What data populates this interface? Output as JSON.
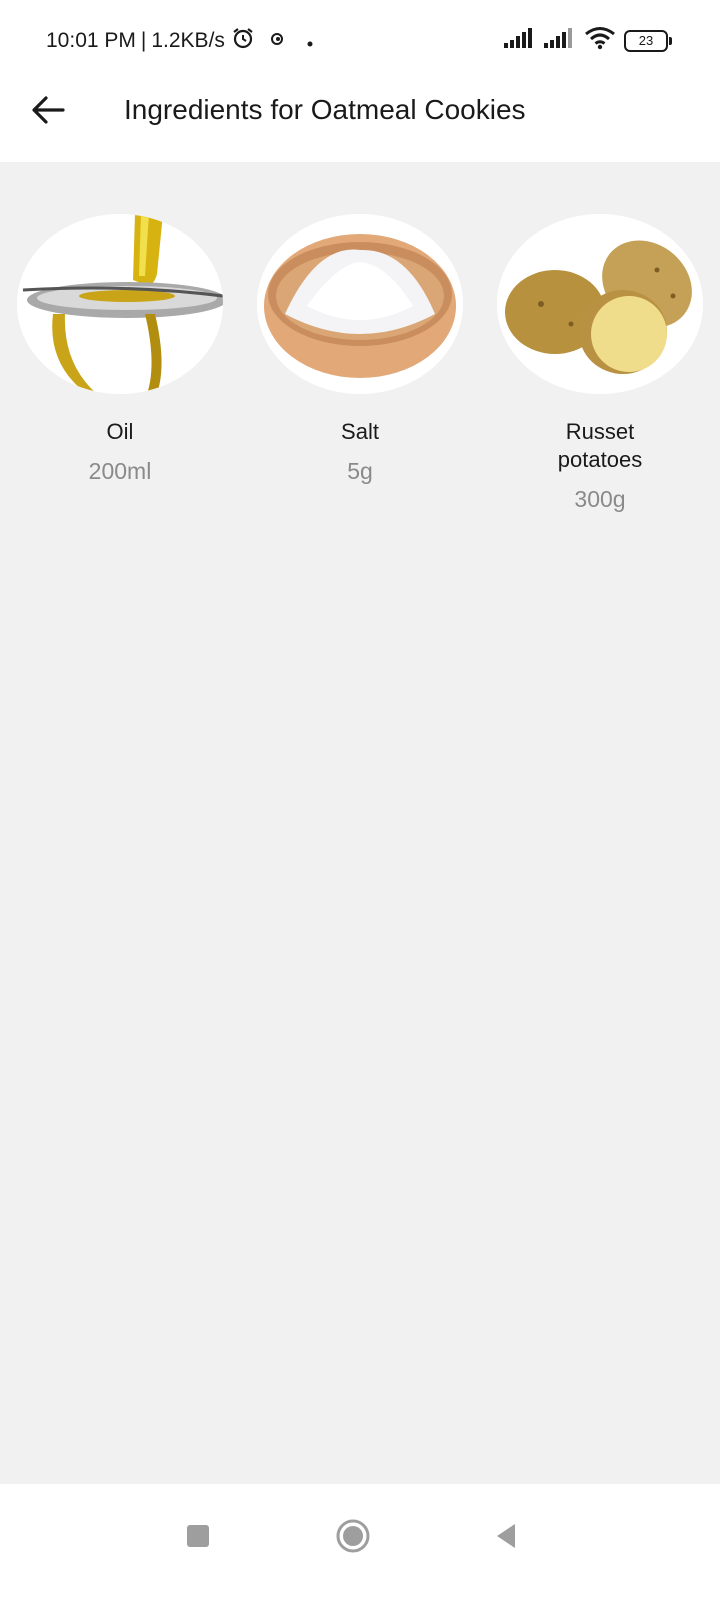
{
  "status_bar": {
    "time": "10:01 PM",
    "separator": "|",
    "network_speed": "1.2KB/s",
    "battery": "23",
    "icons": [
      "alarm-icon",
      "notification-icon",
      "dot-icon",
      "signal-icon",
      "signal-icon",
      "wifi-icon",
      "battery-icon"
    ]
  },
  "header": {
    "title": "Ingredients for Oatmeal Cookies",
    "back_icon": "arrow-left-icon"
  },
  "ingredients": [
    {
      "name": "Oil",
      "quantity": "200ml",
      "image": "oil-image"
    },
    {
      "name": "Salt",
      "quantity": "5g",
      "image": "salt-image"
    },
    {
      "name": "Russet potatoes",
      "quantity": "300g",
      "image": "potatoes-image"
    }
  ],
  "nav_bar": {
    "items": [
      "recents-icon",
      "home-icon",
      "back-triangle-icon"
    ]
  },
  "colors": {
    "background": "#f1f1f1",
    "surface": "#ffffff",
    "text_primary": "#1a1a1a",
    "text_secondary": "#8a8a8a"
  }
}
